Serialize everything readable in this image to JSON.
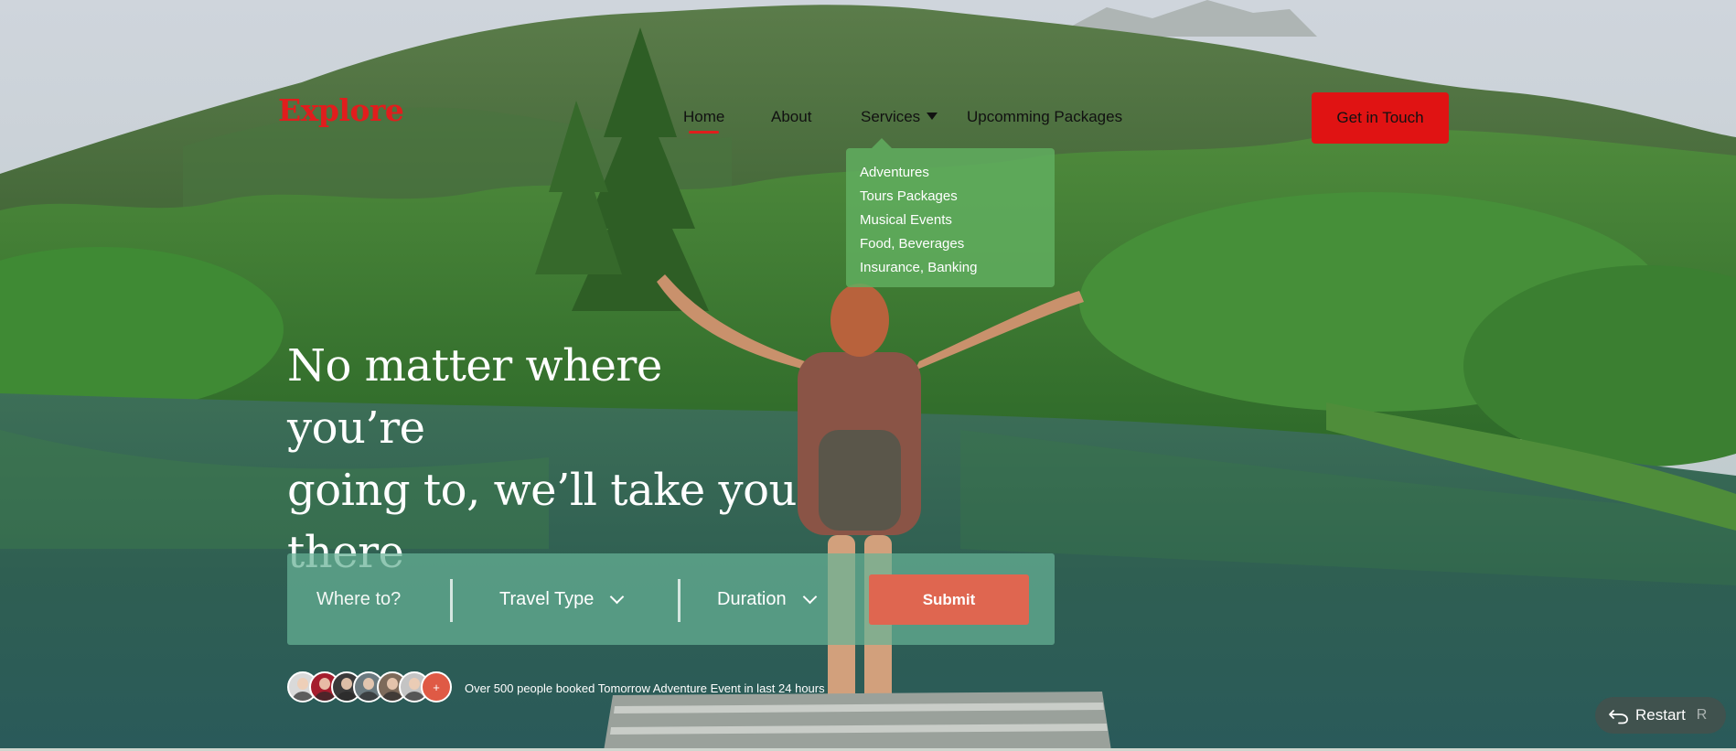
{
  "brand": {
    "logo": "Explore",
    "accent_color": "#e11d1d"
  },
  "nav": {
    "items": [
      {
        "label": "Home",
        "active": true
      },
      {
        "label": "About",
        "active": false
      },
      {
        "label": "Services",
        "active": false,
        "has_dropdown": true
      },
      {
        "label": "Upcomming Packages",
        "active": false
      }
    ],
    "cta_label": "Get in Touch"
  },
  "services_dropdown": {
    "items": [
      "Adventures",
      "Tours Packages",
      "Musical Events",
      "Food, Beverages",
      "Insurance, Banking"
    ]
  },
  "hero": {
    "title_lines": [
      "No matter where you’re",
      "going to, we’ll take you",
      "there"
    ]
  },
  "search": {
    "where_placeholder": "Where to?",
    "travel_type_label": "Travel Type",
    "duration_label": "Duration",
    "submit_label": "Submit",
    "submit_color": "#df6650"
  },
  "social_proof": {
    "more_label": "+",
    "text": "Over 500 people booked Tomorrow Adventure Event in last 24 hours"
  },
  "restart": {
    "label": "Restart",
    "shortcut": "R"
  }
}
